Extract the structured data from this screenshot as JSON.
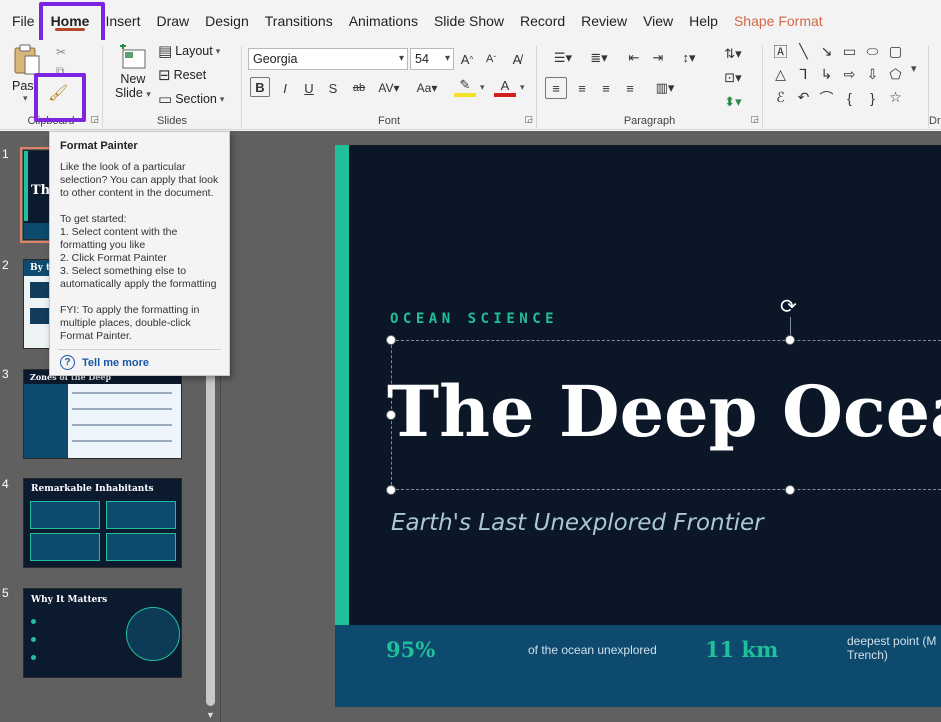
{
  "menu": {
    "tabs": [
      {
        "label": "File"
      },
      {
        "label": "Home"
      },
      {
        "label": "Insert"
      },
      {
        "label": "Draw"
      },
      {
        "label": "Design"
      },
      {
        "label": "Transitions"
      },
      {
        "label": "Animations"
      },
      {
        "label": "Slide Show"
      },
      {
        "label": "Record"
      },
      {
        "label": "Review"
      },
      {
        "label": "View"
      },
      {
        "label": "Help"
      },
      {
        "label": "Shape Format"
      }
    ]
  },
  "ribbon": {
    "clipboard": {
      "label": "Clipboard",
      "paste": "Paste"
    },
    "slides": {
      "label": "Slides",
      "new_slide_line1": "New",
      "new_slide_line2": "Slide",
      "layout": "Layout",
      "reset": "Reset",
      "section": "Section"
    },
    "font": {
      "label": "Font",
      "font_name": "Georgia",
      "font_size": "54"
    },
    "paragraph": {
      "label": "Paragraph"
    },
    "drawing": {
      "label": "Dra"
    }
  },
  "tooltip": {
    "title": "Format Painter",
    "body": "Like the look of a particular selection? You can apply that look to other content in the document.\n\nTo get started:\n1. Select content with the formatting you like\n2. Click Format Painter\n3. Select something else to automatically apply the formatting\n\nFYI: To apply the formatting in multiple places, double-click Format Painter.",
    "link": "Tell me more"
  },
  "thumbnails": [
    {
      "number": "1",
      "title": "The"
    },
    {
      "number": "2",
      "title": "By th"
    },
    {
      "number": "3",
      "title": "Zones of the Deep"
    },
    {
      "number": "4",
      "title": "Remarkable Inhabitants"
    },
    {
      "number": "5",
      "title": "Why It Matters"
    }
  ],
  "slide": {
    "kicker": "OCEAN SCIENCE",
    "title": "The Deep Ocea",
    "subtitle": "Earth's Last Unexplored Frontier",
    "stats": {
      "value1": "95%",
      "label1": "of the ocean unexplored",
      "value2": "11 km",
      "label2": "deepest point (M\nTrench)"
    }
  },
  "colors": {
    "accent_teal": "#1fc09a",
    "highlight_purple": "#7c24e0",
    "slide_bg": "#0b1626"
  }
}
